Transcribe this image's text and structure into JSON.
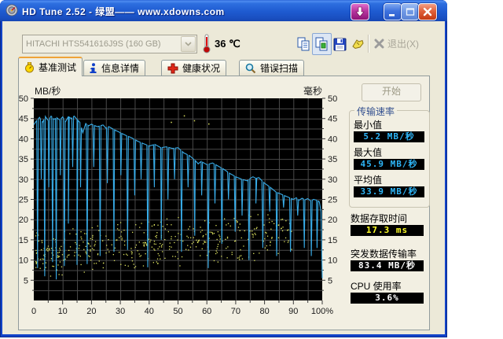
{
  "window": {
    "title": "HD Tune 2.52 - 绿盟—— www.xdowns.com",
    "controls": [
      "download",
      "minimize",
      "maximize",
      "close"
    ]
  },
  "toolbar": {
    "drive_combo": {
      "value": "HITACHI HTS541616J9S (160 GB)"
    },
    "temperature": {
      "value": "36",
      "unit": "℃"
    },
    "icons": [
      "copy",
      "copy-image",
      "save",
      "options"
    ],
    "exit_label": "退出(X)"
  },
  "tabs": {
    "active": 0,
    "items": [
      {
        "label": "基准测试",
        "icon": "benchmark"
      },
      {
        "label": "信息详情",
        "icon": "info"
      },
      {
        "label": "健康状况",
        "icon": "health"
      },
      {
        "label": "错误扫描",
        "icon": "error-scan"
      }
    ]
  },
  "main": {
    "start_button": "开始"
  },
  "stats": {
    "group_title": "传输速率",
    "min": {
      "label": "最小值",
      "value": "5.2 MB/秒",
      "color": "#2EB6F8"
    },
    "max": {
      "label": "最大值",
      "value": "45.9 MB/秒",
      "color": "#2EB6F8"
    },
    "avg": {
      "label": "平均值",
      "value": "33.9 MB/秒",
      "color": "#2EB6F8"
    },
    "access": {
      "label": "数据存取时间",
      "value": "17.3 ms",
      "color": "#FFFF28"
    },
    "burst": {
      "label": "突发数据传输率",
      "value": "83.4 MB/秒",
      "color": "#FFFFFF"
    },
    "cpu": {
      "label": "CPU 使用率",
      "value": "3.6%",
      "color": "#FFFFFF"
    }
  },
  "chart_data": {
    "type": "line+scatter",
    "title": "HD Tune benchmark - transfer rate (line) and access time (dots)",
    "y_left_label": "MB/秒",
    "y_right_label": "毫秒",
    "x_tick_labels": [
      "0",
      "10",
      "20",
      "30",
      "40",
      "50",
      "60",
      "70",
      "80",
      "90",
      "100%"
    ],
    "y_ticks": [
      5,
      10,
      15,
      20,
      25,
      30,
      35,
      40,
      45,
      50
    ],
    "y_max": 50,
    "x_grid_step": 5,
    "y_grid_step": 2.5,
    "grid": true,
    "colors": {
      "bg": "#000000",
      "grid": "#4A4A4A",
      "line": "#38ACE8",
      "dots": "#DDE25F"
    },
    "transfer_rate": {
      "unit": "MB/秒",
      "min": 5.2,
      "max": 45.9,
      "avg": 33.9,
      "base": [
        [
          0,
          43.5
        ],
        [
          1,
          44.5
        ],
        [
          2,
          45.3
        ],
        [
          3,
          44.0
        ],
        [
          4,
          45.5
        ],
        [
          5,
          44.5
        ],
        [
          6,
          45.6
        ],
        [
          7,
          44.8
        ],
        [
          8,
          45.2
        ],
        [
          9,
          44.6
        ],
        [
          10,
          45.4
        ],
        [
          11,
          44.2
        ],
        [
          12,
          45.5
        ],
        [
          13,
          45.0
        ],
        [
          14,
          45.6
        ],
        [
          15,
          44.8
        ],
        [
          16,
          44.0
        ],
        [
          17,
          41.5
        ],
        [
          18,
          43.8
        ],
        [
          19,
          43.2
        ],
        [
          20,
          43.6
        ],
        [
          22,
          43.0
        ],
        [
          24,
          43.4
        ],
        [
          25,
          42.6
        ],
        [
          26,
          43.0
        ],
        [
          28,
          42.2
        ],
        [
          30,
          41.5
        ],
        [
          32,
          40.8
        ],
        [
          34,
          40.2
        ],
        [
          36,
          39.4
        ],
        [
          38,
          38.8
        ],
        [
          40,
          38.2
        ],
        [
          42,
          38.6
        ],
        [
          44,
          37.8
        ],
        [
          46,
          38.0
        ],
        [
          48,
          37.6
        ],
        [
          50,
          37.8
        ],
        [
          52,
          36.5
        ],
        [
          54,
          35.8
        ],
        [
          56,
          34.6
        ],
        [
          57,
          33.8
        ],
        [
          58,
          34.4
        ],
        [
          60,
          33.6
        ],
        [
          62,
          34.0
        ],
        [
          64,
          33.2
        ],
        [
          66,
          32.4
        ],
        [
          68,
          31.4
        ],
        [
          70,
          30.6
        ],
        [
          72,
          30.0
        ],
        [
          74,
          29.6
        ],
        [
          75,
          30.2
        ],
        [
          76,
          30.6
        ],
        [
          77,
          30.2
        ],
        [
          78,
          30.4
        ],
        [
          80,
          29.0
        ],
        [
          82,
          28.0
        ],
        [
          84,
          26.8
        ],
        [
          86,
          26.2
        ],
        [
          88,
          25.6
        ],
        [
          90,
          25.0
        ],
        [
          91,
          25.4
        ],
        [
          92,
          24.8
        ],
        [
          93,
          25.3
        ],
        [
          94,
          24.9
        ],
        [
          95,
          25.2
        ],
        [
          96,
          24.6
        ],
        [
          97,
          25.0
        ],
        [
          98,
          24.8
        ],
        [
          99,
          24.4
        ],
        [
          99.6,
          22.0
        ],
        [
          100,
          5.5
        ]
      ],
      "spikes": [
        [
          1.3,
          8
        ],
        [
          2.6,
          30
        ],
        [
          3.8,
          6
        ],
        [
          5.2,
          28
        ],
        [
          6.5,
          9.5
        ],
        [
          7.8,
          5.2
        ],
        [
          9.2,
          31
        ],
        [
          10.6,
          8.5
        ],
        [
          12,
          19
        ],
        [
          13.5,
          33
        ],
        [
          15,
          8.8
        ],
        [
          16.2,
          28
        ],
        [
          18.5,
          9
        ],
        [
          20.8,
          33
        ],
        [
          23,
          11
        ],
        [
          25.5,
          29
        ],
        [
          27.8,
          12
        ],
        [
          30.2,
          31
        ],
        [
          32.5,
          12.5
        ],
        [
          35,
          26
        ],
        [
          37.2,
          30
        ],
        [
          39.5,
          8.2
        ],
        [
          41.8,
          28
        ],
        [
          44.2,
          15
        ],
        [
          46.5,
          25
        ],
        [
          48.8,
          30
        ],
        [
          51.2,
          12
        ],
        [
          53.5,
          28
        ],
        [
          55.8,
          16
        ],
        [
          58.2,
          26
        ],
        [
          60.5,
          8
        ],
        [
          62.8,
          24
        ],
        [
          65.2,
          14
        ],
        [
          67.5,
          25
        ],
        [
          69.8,
          17
        ],
        [
          72.2,
          21
        ],
        [
          74.6,
          10
        ],
        [
          77,
          24
        ],
        [
          79.4,
          13
        ],
        [
          81.8,
          22
        ],
        [
          84.2,
          11
        ],
        [
          86.6,
          23
        ],
        [
          89,
          12
        ],
        [
          91.5,
          21
        ],
        [
          93.8,
          13
        ],
        [
          96.2,
          11
        ],
        [
          98.2,
          13
        ]
      ]
    },
    "access_scatter": {
      "unit": "ms",
      "avg": 17.3,
      "seed": 7,
      "count": 430,
      "x_min": 0.5,
      "x_max": 90,
      "x_bias": 1.3,
      "y_left": 11.5,
      "y_right": 17.5,
      "y_spread": 6.5,
      "y_min": 3.5,
      "y_max": 26,
      "outliers": [
        [
          47.5,
          44.2
        ],
        [
          52,
          45.8
        ],
        [
          55.5,
          44.6
        ],
        [
          60.5,
          43.8
        ]
      ]
    }
  }
}
